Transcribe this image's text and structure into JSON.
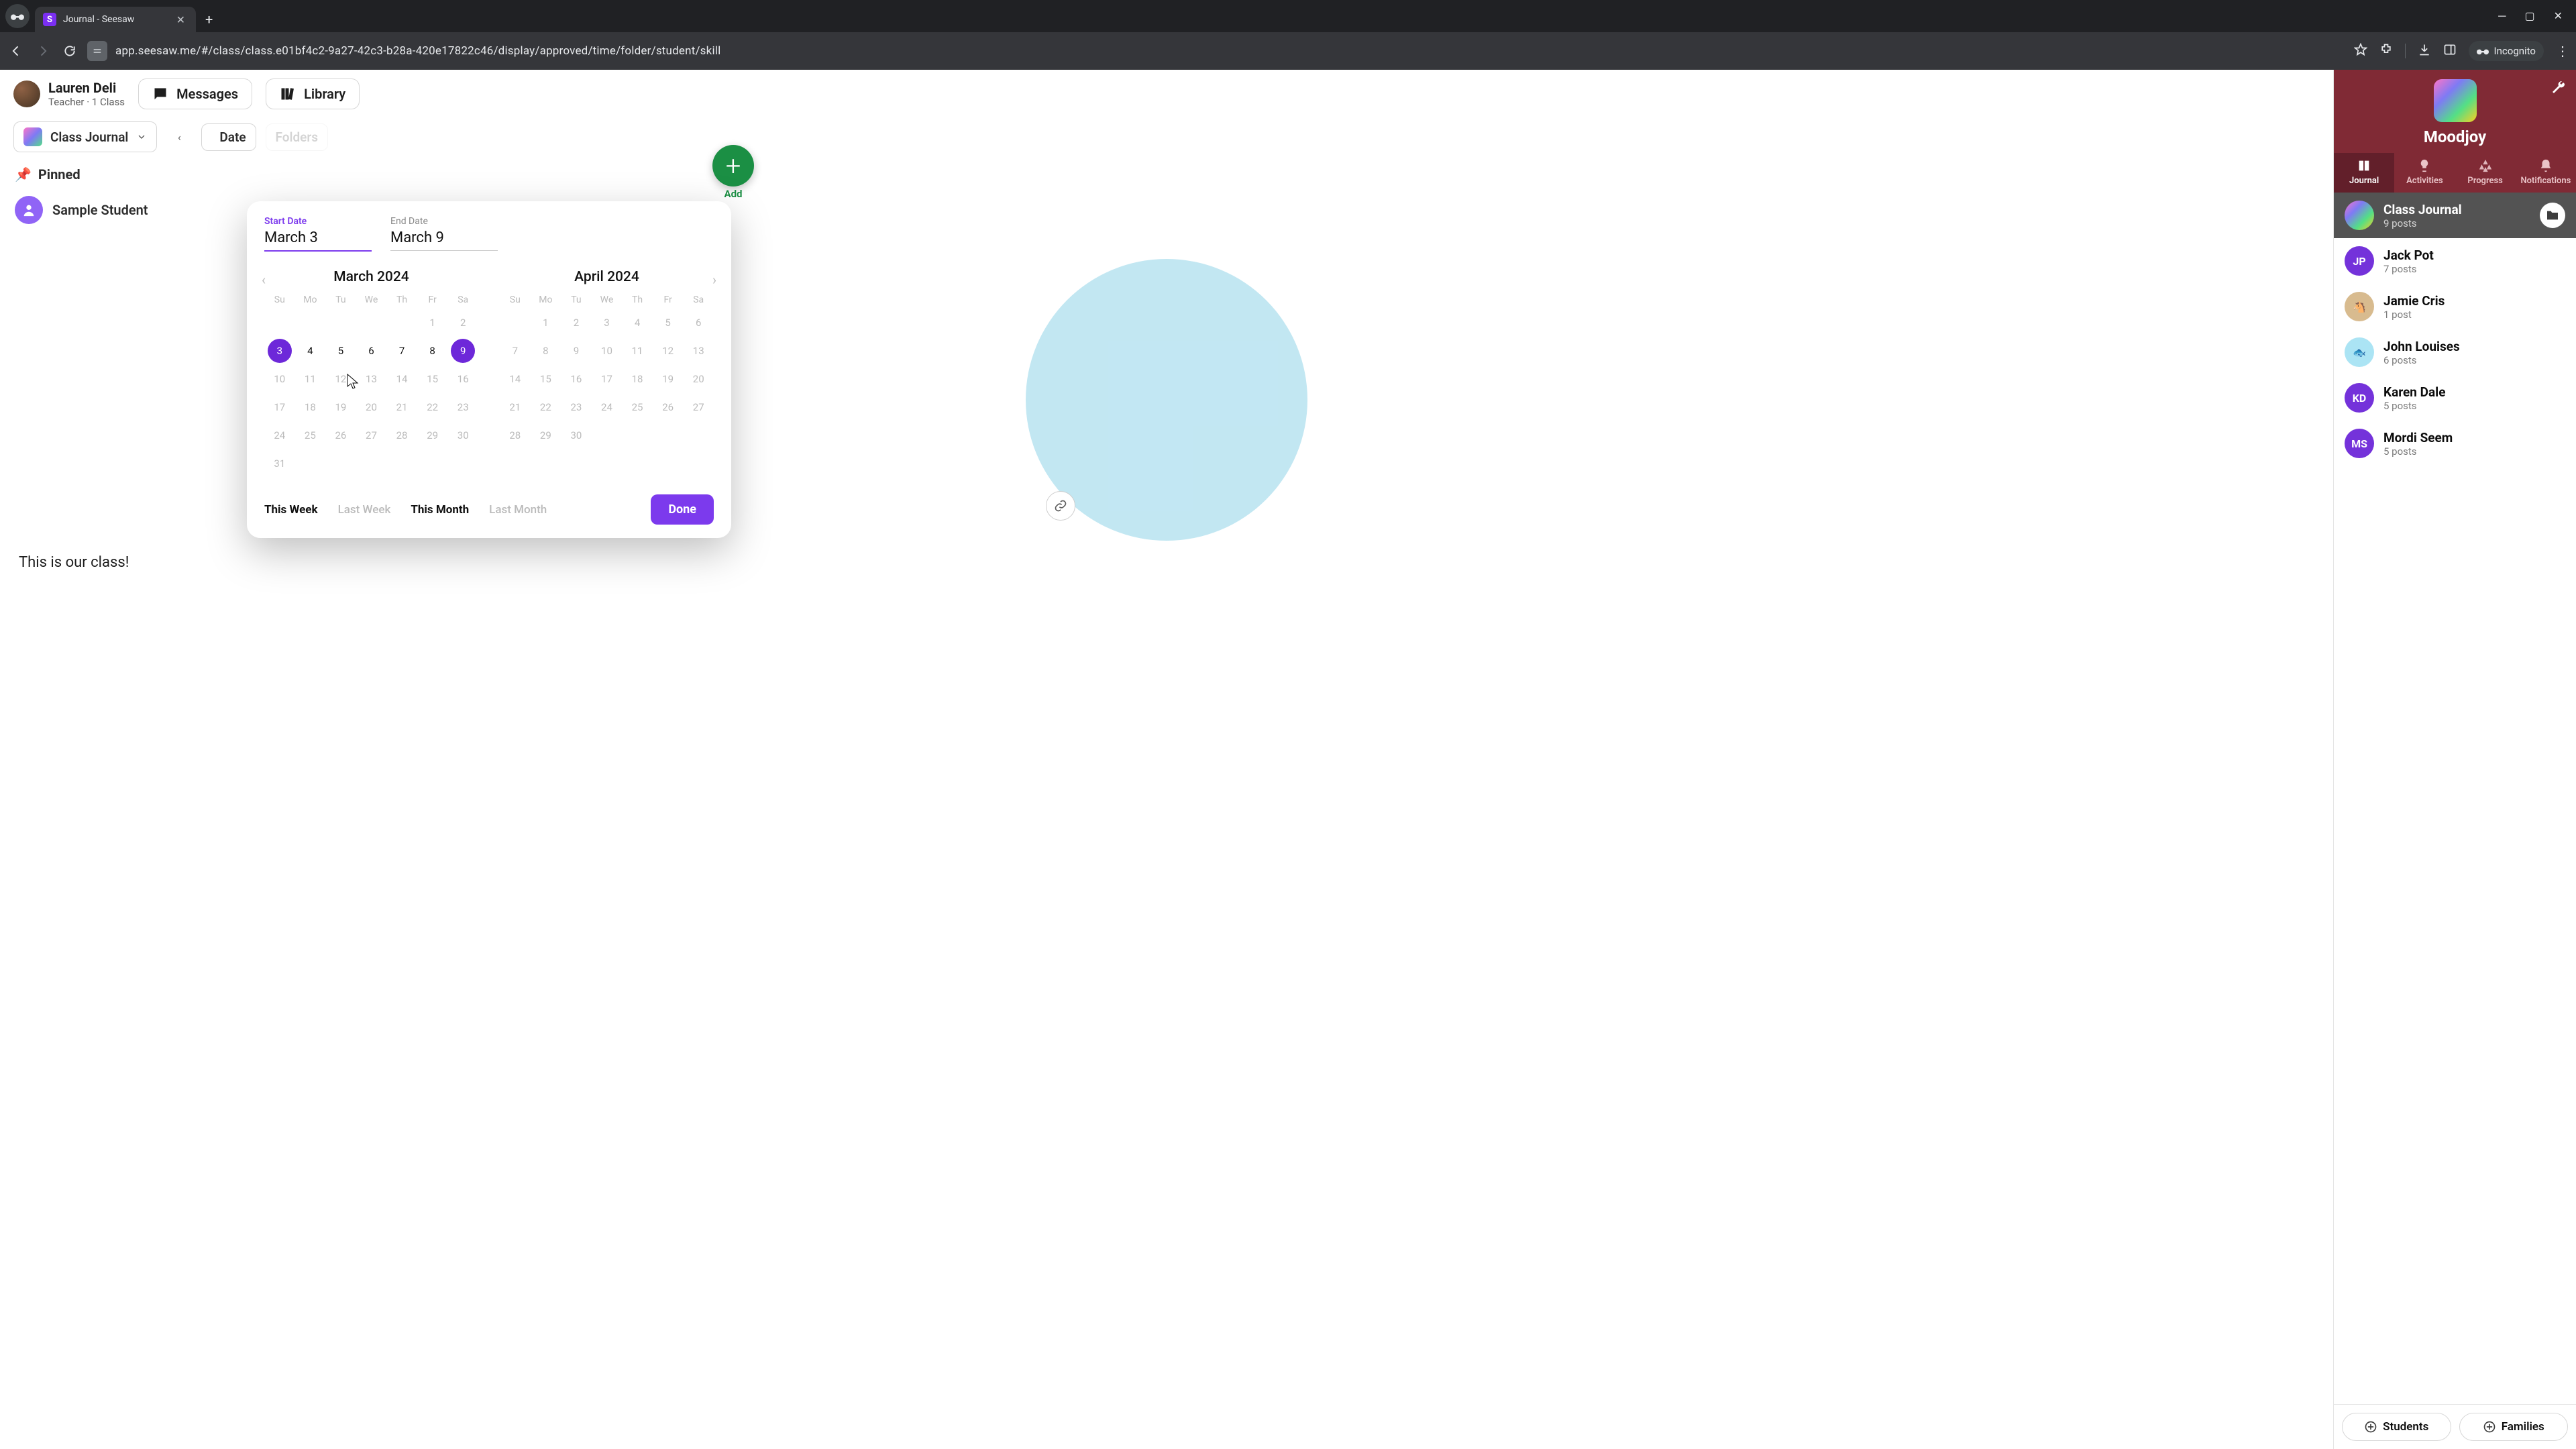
{
  "browser": {
    "tab_title": "Journal - Seesaw",
    "url": "app.seesaw.me/#/class/class.e01bf4c2-9a27-42c3-b28a-420e17822c46/display/approved/time/folder/student/skill",
    "incognito_label": "Incognito"
  },
  "header": {
    "user_name": "Lauren Deli",
    "user_role": "Teacher · 1 Class",
    "messages": "Messages",
    "library": "Library",
    "add": "Add"
  },
  "toolbar": {
    "class_journal": "Class Journal",
    "date": "Date",
    "folders": "Folders"
  },
  "journal": {
    "pinned": "Pinned",
    "sample_student": "Sample Student",
    "caption": "This is our class!"
  },
  "sidebar": {
    "brand": "Moodjoy",
    "tabs": {
      "journal": "Journal",
      "activities": "Activities",
      "progress": "Progress",
      "notifications": "Notifications"
    },
    "items": [
      {
        "name": "Class Journal",
        "sub": "9 posts",
        "initials": "",
        "color": "gradient"
      },
      {
        "name": "Jack Pot",
        "sub": "7 posts",
        "initials": "JP",
        "color": "#6d28d9"
      },
      {
        "name": "Jamie Cris",
        "sub": "1 post",
        "initials": "🐴",
        "color": "#d6b88a"
      },
      {
        "name": "John Louises",
        "sub": "6 posts",
        "initials": "🐟",
        "color": "#a7e3f4"
      },
      {
        "name": "Karen Dale",
        "sub": "5 posts",
        "initials": "KD",
        "color": "#6d28d9"
      },
      {
        "name": "Mordi Seem",
        "sub": "5 posts",
        "initials": "MS",
        "color": "#6d28d9"
      }
    ],
    "students_btn": "Students",
    "families_btn": "Families"
  },
  "datepicker": {
    "start_label": "Start Date",
    "end_label": "End Date",
    "start_value": "March 3",
    "end_value": "March 9",
    "dow": [
      "Su",
      "Mo",
      "Tu",
      "We",
      "Th",
      "Fr",
      "Sa"
    ],
    "months": [
      {
        "title": "March 2024",
        "leading_blanks": 5,
        "days": 31,
        "range_start": 3,
        "range_end": 9
      },
      {
        "title": "April 2024",
        "leading_blanks": 1,
        "days": 30,
        "range_start": 0,
        "range_end": 0
      }
    ],
    "presets": {
      "this_week": "This Week",
      "last_week": "Last Week",
      "this_month": "This Month",
      "last_month": "Last Month"
    },
    "done": "Done"
  }
}
